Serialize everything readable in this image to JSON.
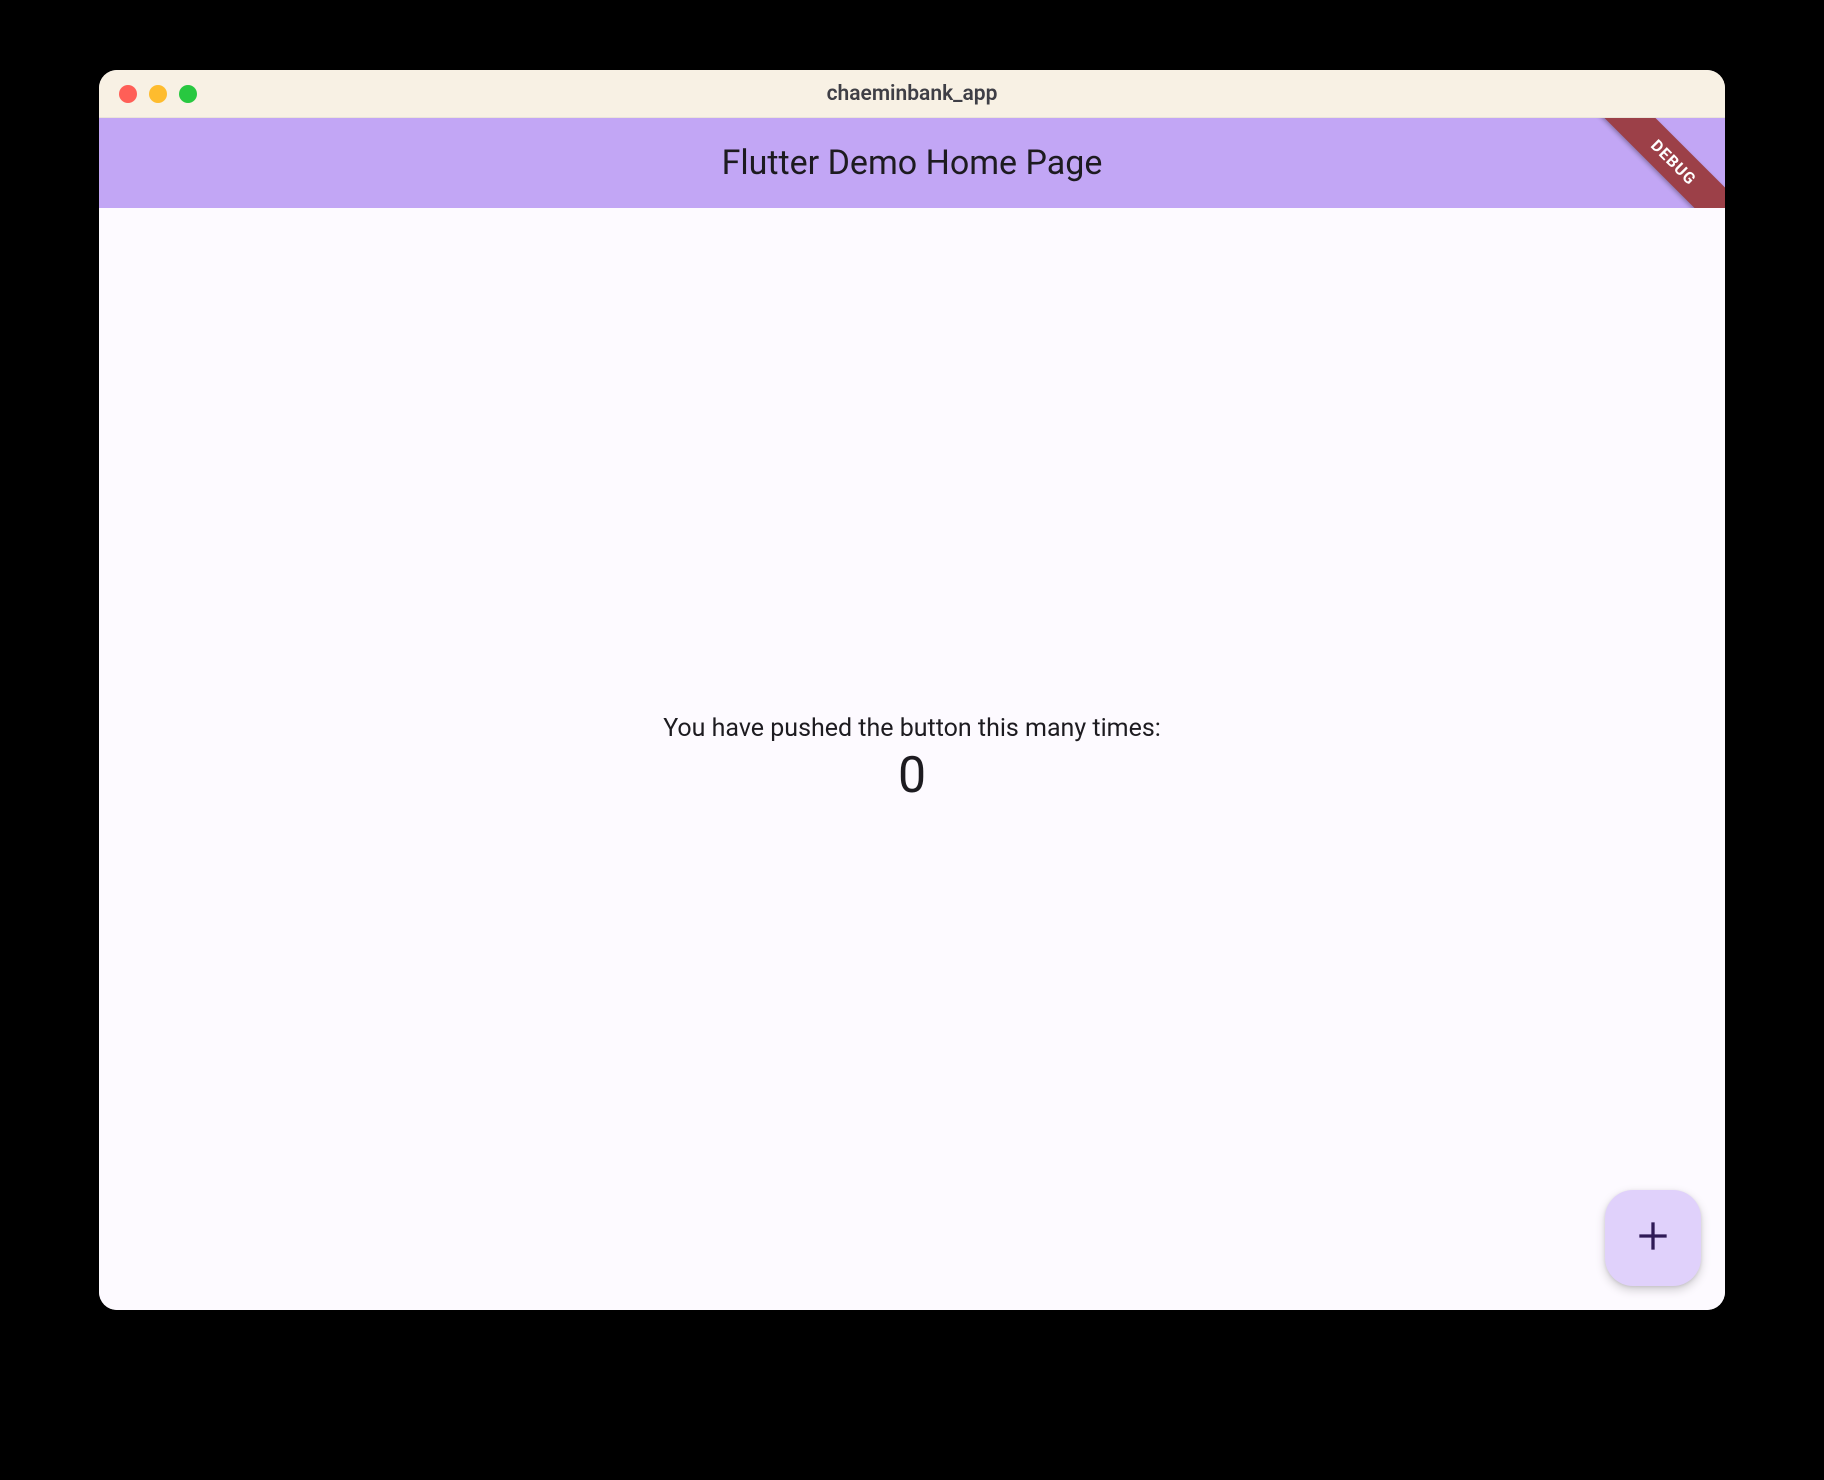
{
  "window": {
    "title": "chaeminbank_app"
  },
  "appbar": {
    "title": "Flutter Demo Home Page"
  },
  "debug": {
    "label": "DEBUG"
  },
  "body": {
    "message": "You have pushed the button this many times:",
    "counter": "0"
  },
  "fab": {
    "icon_name": "plus-icon"
  },
  "colors": {
    "appbar_bg": "#c2a6f5",
    "fab_bg": "#e0d1fb",
    "fab_icon": "#2f1a56",
    "debug_bg": "#9c4048",
    "content_bg": "#fdfaff",
    "titlebar_bg": "#f8f1e4"
  }
}
